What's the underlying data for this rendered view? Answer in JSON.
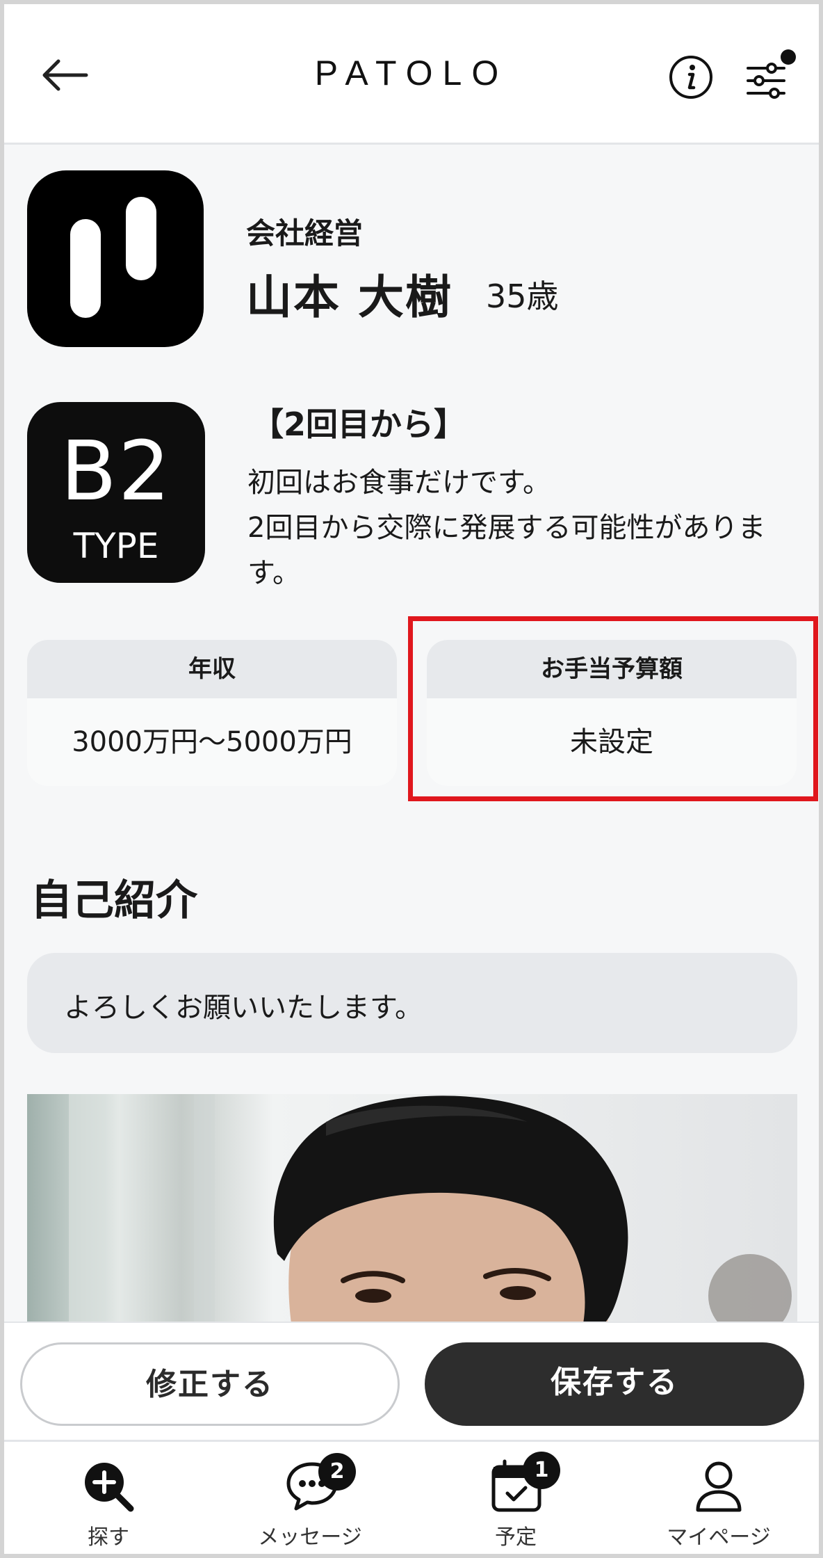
{
  "header": {
    "logo": "PATOLO",
    "back_icon": "arrow-left-icon",
    "info_icon": "info-icon",
    "filter_icon": "sliders-icon"
  },
  "profile": {
    "occupation": "会社経営",
    "name": "山本 大樹",
    "age": "35歳"
  },
  "type": {
    "code": "B2",
    "label": "TYPE",
    "title": "【2回目から】",
    "description_line1": "初回はお食事だけです。",
    "description_line2": "2回目から交際に発展する可能性がありま",
    "description_line3": "す。"
  },
  "stats": {
    "income_label": "年収",
    "income_value": "3000万円〜5000万円",
    "budget_label": "お手当予算額",
    "budget_value": "未設定",
    "highlight_color": "#e0171d"
  },
  "intro": {
    "title": "自己紹介",
    "text": "よろしくお願いいたします。"
  },
  "actions": {
    "edit_label": "修正する",
    "save_label": "保存する"
  },
  "tabs": [
    {
      "label": "探す",
      "icon": "search-plus-icon"
    },
    {
      "label": "メッセージ",
      "icon": "chat-bubble-icon",
      "badge": "2"
    },
    {
      "label": "予定",
      "icon": "calendar-check-icon",
      "badge": "1"
    },
    {
      "label": "マイページ",
      "icon": "user-icon"
    }
  ]
}
